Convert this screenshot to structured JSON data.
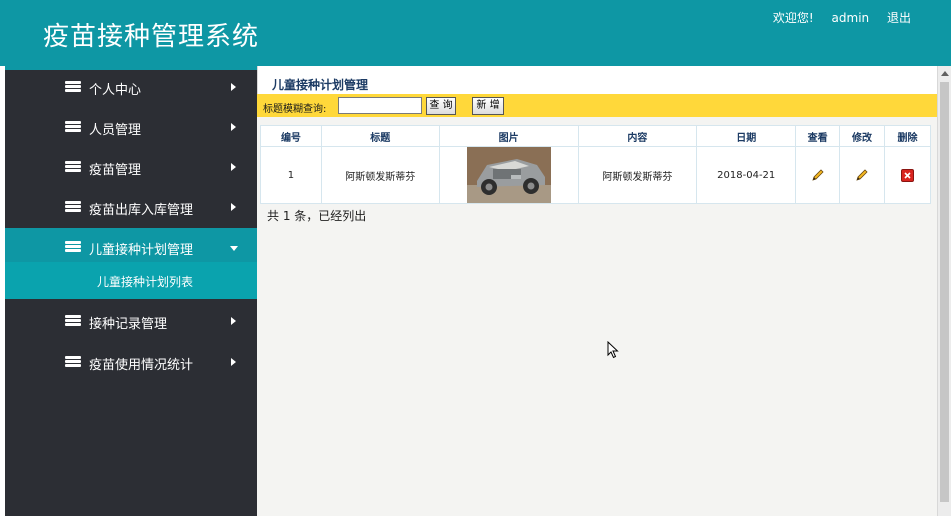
{
  "header": {
    "app_title": "疫苗接种管理系统",
    "welcome": "欢迎您!",
    "username": "admin",
    "logout": "退出"
  },
  "sidebar": {
    "items": [
      {
        "label": "个人中心"
      },
      {
        "label": "人员管理"
      },
      {
        "label": "疫苗管理"
      },
      {
        "label": "疫苗出库入库管理"
      },
      {
        "label": "儿童接种计划管理",
        "active": true
      },
      {
        "label": "接种记录管理"
      },
      {
        "label": "疫苗使用情况统计"
      }
    ],
    "subitem": {
      "label": "儿童接种计划列表"
    }
  },
  "main": {
    "breadcrumb": "儿童接种计划管理",
    "search": {
      "label": "标题模糊查询:",
      "value": "",
      "query_button": "查 询",
      "add_button": "新 增"
    },
    "table": {
      "headers": [
        "编号",
        "标题",
        "图片",
        "内容",
        "日期",
        "查看",
        "修改",
        "删除"
      ],
      "rows": [
        {
          "id": "1",
          "title": "阿斯顿发斯蒂芬",
          "content": "阿斯顿发斯蒂芬",
          "date": "2018-04-21"
        }
      ]
    },
    "total_text": "共 1 条，已经列出"
  },
  "colors": {
    "header_bg": "#0e97a4",
    "sidebar_bg": "#2c2e34",
    "search_bar_bg": "#ffd83a",
    "active_nav": "#0e97a4"
  },
  "icons": {
    "nav": "stack-icon",
    "view": "pencil-icon",
    "edit": "pencil-icon",
    "delete": "delete-x-icon"
  }
}
